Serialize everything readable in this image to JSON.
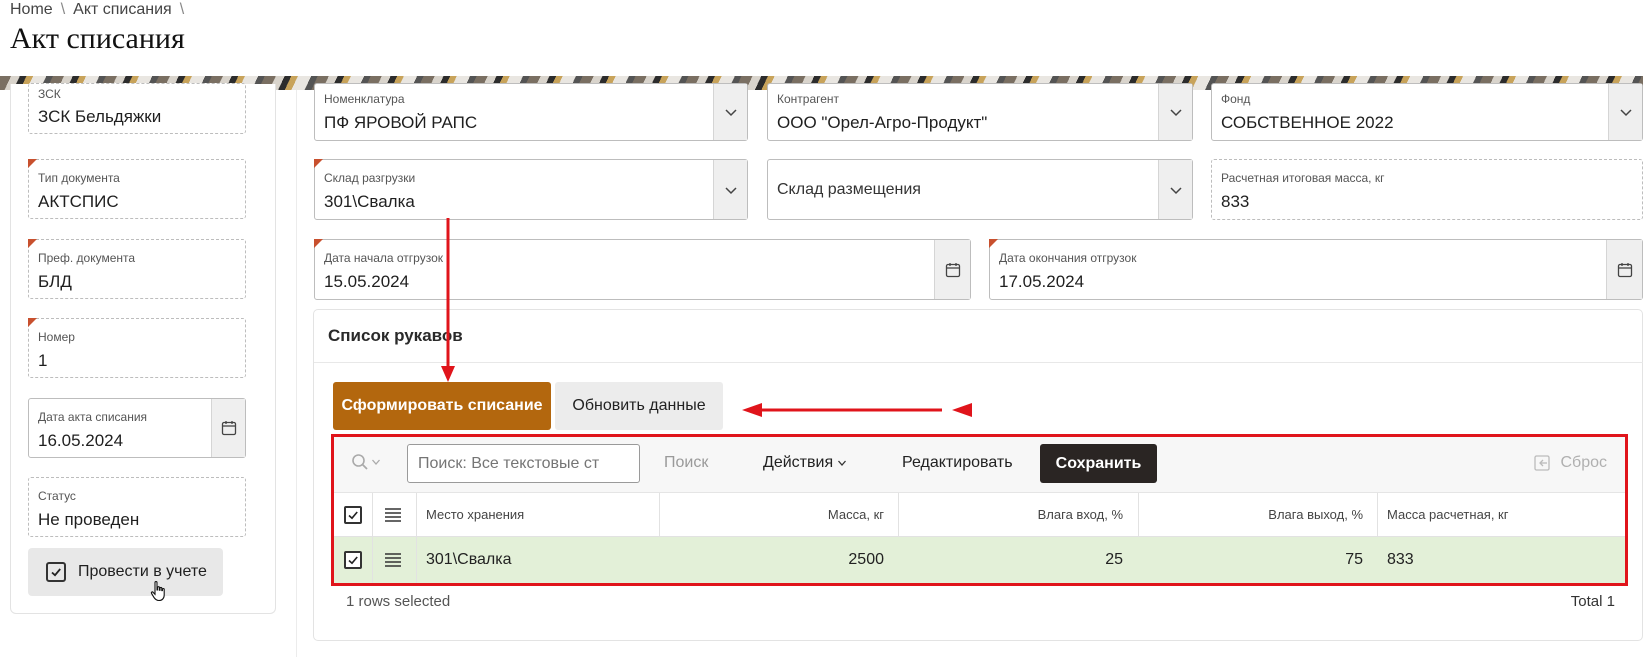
{
  "breadcrumb": {
    "home": "Home",
    "current": "Акт списания",
    "separator": "\\"
  },
  "page_title": "Акт списания",
  "left_fields": {
    "zsk": {
      "label": "ЗСК",
      "value": "ЗСК Бельдяжки"
    },
    "doc_type": {
      "label": "Тип документа",
      "value": "АКТСПИС"
    },
    "doc_prefix": {
      "label": "Преф. документа",
      "value": "БЛД"
    },
    "number": {
      "label": "Номер",
      "value": "1"
    },
    "act_date": {
      "label": "Дата акта списания",
      "value": "16.05.2024"
    },
    "status": {
      "label": "Статус",
      "value": "Не проведен"
    }
  },
  "post_button": {
    "label": "Провести в учете",
    "checked": true
  },
  "main_fields": {
    "nomenclature": {
      "label": "Номенклатура",
      "value": "ПФ ЯРОВОЙ РАПС"
    },
    "counterparty": {
      "label": "Контрагент",
      "value": "ООО \"Орел-Агро-Продукт\""
    },
    "fund": {
      "label": "Фонд",
      "value": "СОБСТВЕННОЕ 2022"
    },
    "unload_storage": {
      "label": "Склад разгрузки",
      "value": "301\\Свалка"
    },
    "placement_storage": {
      "placeholder": "Склад размещения"
    },
    "calc_mass": {
      "label": "Расчетная итоговая масса, кг",
      "value": "833"
    },
    "ship_start": {
      "label": "Дата начала отгрузок",
      "value": "15.05.2024"
    },
    "ship_end": {
      "label": "Дата окончания отгрузок",
      "value": "17.05.2024"
    }
  },
  "region": {
    "title": "Список рукавов"
  },
  "buttons": {
    "form": "Сформировать списание",
    "refresh": "Обновить данные"
  },
  "toolbar": {
    "search_placeholder": "Поиск: Все текстовые ст",
    "go": "Поиск",
    "actions": "Действия",
    "edit": "Редактировать",
    "save": "Сохранить",
    "reset": "Сброс"
  },
  "table": {
    "columns": [
      "Место хранения",
      "Масса, кг",
      "Влага вход, %",
      "Влага выход, %",
      "Масса расчетная, кг"
    ],
    "rows": [
      {
        "storage": "301\\Свалка",
        "mass": "2500",
        "moist_in": "25",
        "moist_out": "75",
        "calc_mass": "833",
        "selected": true
      }
    ]
  },
  "footer": {
    "selected": "1 rows selected",
    "total": "Total 1"
  },
  "colors": {
    "accent": "#b3670e",
    "highlight": "#e0141b",
    "row_selected": "#e3f0d8",
    "required": "#c8502e"
  }
}
